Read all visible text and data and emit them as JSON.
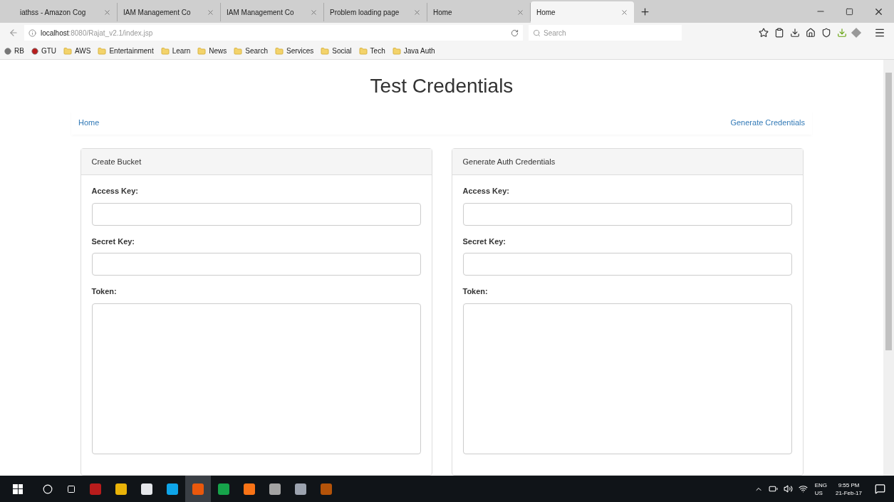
{
  "browser": {
    "tabs": [
      {
        "title": "iathss - Amazon Cog",
        "selected": false
      },
      {
        "title": "IAM Management Co",
        "selected": false
      },
      {
        "title": "IAM Management Co",
        "selected": false
      },
      {
        "title": "Problem loading page",
        "selected": false
      },
      {
        "title": "Home",
        "selected": false
      },
      {
        "title": "Home",
        "selected": true
      }
    ],
    "url_host": "localhost",
    "url_path": ":8080/Rajat_v2.1/index.jsp",
    "search": {
      "placeholder": "Search"
    },
    "bookmarks": [
      {
        "label": "RB",
        "kind": "site"
      },
      {
        "label": "GTU",
        "kind": "site"
      },
      {
        "label": "AWS",
        "kind": "folder"
      },
      {
        "label": "Entertainment",
        "kind": "folder"
      },
      {
        "label": "Learn",
        "kind": "folder"
      },
      {
        "label": "News",
        "kind": "folder"
      },
      {
        "label": "Search",
        "kind": "folder"
      },
      {
        "label": "Services",
        "kind": "folder"
      },
      {
        "label": "Social",
        "kind": "folder"
      },
      {
        "label": "Tech",
        "kind": "folder"
      },
      {
        "label": "Java Auth",
        "kind": "folder"
      }
    ]
  },
  "page": {
    "title": "Test Credentials",
    "nav": [
      {
        "label": "Home"
      },
      {
        "label": "Generate Credentials"
      }
    ],
    "panels": [
      {
        "heading": "Create Bucket",
        "fields": [
          {
            "label": "Access Key:",
            "kind": "input"
          },
          {
            "label": "Secret Key:",
            "kind": "input"
          },
          {
            "label": "Token:",
            "kind": "textarea"
          }
        ]
      },
      {
        "heading": "Generate Auth Credentials",
        "fields": [
          {
            "label": "Access Key:",
            "kind": "input"
          },
          {
            "label": "Secret Key:",
            "kind": "input"
          },
          {
            "label": "Token:",
            "kind": "textarea"
          }
        ]
      }
    ]
  },
  "taskbar": {
    "language": "ENG",
    "region": "US",
    "time": "9:55 PM",
    "date": "21-Feb-17"
  }
}
